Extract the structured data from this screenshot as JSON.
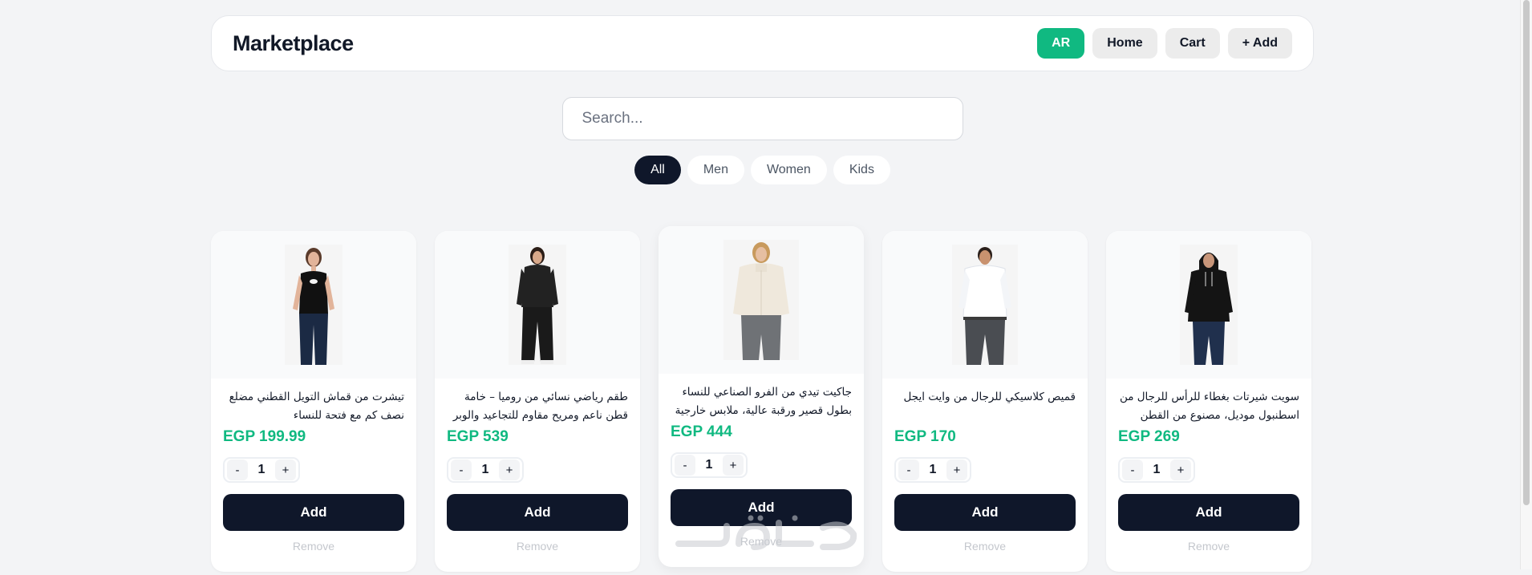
{
  "header": {
    "brand": "Marketplace",
    "nav": [
      {
        "label": "AR"
      },
      {
        "label": "Home"
      },
      {
        "label": "Cart"
      },
      {
        "label": "+ Add"
      }
    ]
  },
  "search": {
    "placeholder": "Search..."
  },
  "filters": [
    {
      "label": "All"
    },
    {
      "label": "Men"
    },
    {
      "label": "Women"
    },
    {
      "label": "Kids"
    }
  ],
  "products": [
    {
      "title": "تيشرت من قماش التويل القطني مضلع نصف كم مع فتحة للنساء",
      "price": "EGP 199.99",
      "qty": "1",
      "add_label": "Add",
      "remove_label": "Remove",
      "icon": "woman-black-top"
    },
    {
      "title": "طقم رياضي نسائي من روميا – خامة قطن ناعم ومريح مقاوم للتجاعيد والوبر – ترنج",
      "price": "EGP 539",
      "qty": "1",
      "add_label": "Add",
      "remove_label": "Remove",
      "icon": "woman-tracksuit"
    },
    {
      "title": "جاكيت تيدي من الفرو الصناعي للنساء بطول قصير ورقبة عالية، ملابس خارجية",
      "price": "EGP 444",
      "qty": "1",
      "add_label": "Add",
      "remove_label": "Remove",
      "icon": "woman-teddy-jacket"
    },
    {
      "title": "قميص كلاسيكي للرجال من وايت ايجل",
      "price": "EGP 170",
      "qty": "1",
      "add_label": "Add",
      "remove_label": "Remove",
      "icon": "man-white-shirt"
    },
    {
      "title": "سويت شيرتات بغطاء للرأس للرجال من اسطنبول موديل، مصنوع من القطن",
      "price": "EGP 269",
      "qty": "1",
      "add_label": "Add",
      "remove_label": "Remove",
      "icon": "man-black-hoodie"
    }
  ],
  "stepper": {
    "minus": "-",
    "plus": "+"
  },
  "colors": {
    "accent": "#10b981",
    "dark": "#0f172a",
    "background": "#f3f4f6"
  },
  "watermark": "خمسات"
}
